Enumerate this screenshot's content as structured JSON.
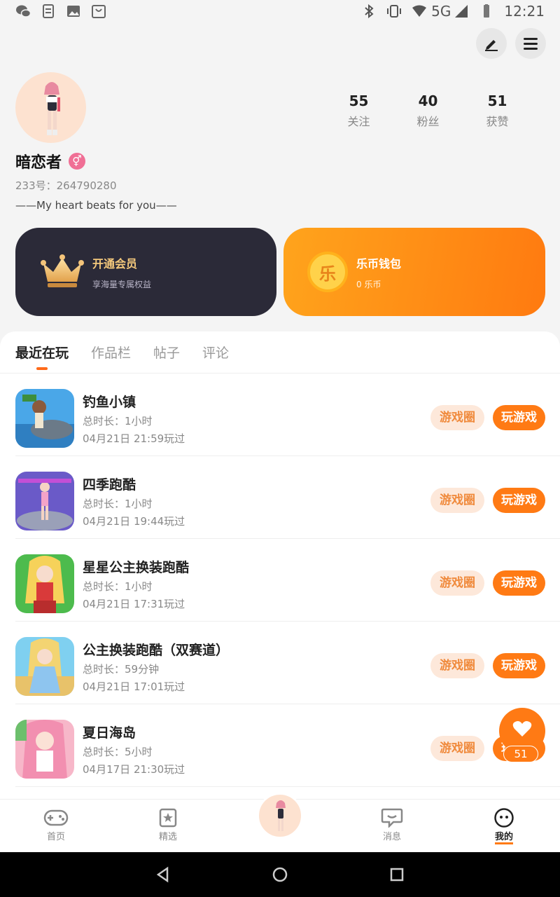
{
  "status_bar": {
    "network": "5G",
    "time": "12:21"
  },
  "profile": {
    "username": "暗恋者",
    "gender_symbol": "⚥",
    "uid_text": "233号：264790280",
    "bio": "——My heart beats for you——",
    "stats": [
      {
        "num": "55",
        "label": "关注"
      },
      {
        "num": "40",
        "label": "粉丝"
      },
      {
        "num": "51",
        "label": "获赞"
      }
    ]
  },
  "cards": {
    "vip": {
      "title": "开通会员",
      "subtitle": "享海量专属权益"
    },
    "wallet": {
      "icon_text": "乐",
      "title": "乐币钱包",
      "subtitle": "0 乐币"
    }
  },
  "tabs": [
    "最近在玩",
    "作品栏",
    "帖子",
    "评论"
  ],
  "games": [
    {
      "name": "钓鱼小镇",
      "duration": "总时长：1小时",
      "last_played": "04月21日 21:59玩过",
      "circle_label": "游戏圈",
      "play_label": "玩游戏"
    },
    {
      "name": "四季跑酷",
      "duration": "总时长：1小时",
      "last_played": "04月21日 19:44玩过",
      "circle_label": "游戏圈",
      "play_label": "玩游戏"
    },
    {
      "name": "星星公主换装跑酷",
      "duration": "总时长：1小时",
      "last_played": "04月21日 17:31玩过",
      "circle_label": "游戏圈",
      "play_label": "玩游戏"
    },
    {
      "name": "公主换装跑酷（双赛道）",
      "duration": "总时长：59分钟",
      "last_played": "04月21日 17:01玩过",
      "circle_label": "游戏圈",
      "play_label": "玩游戏"
    },
    {
      "name": "夏日海岛",
      "duration": "总时长：5小时",
      "last_played": "04月17日 21:30玩过",
      "circle_label": "游戏圈",
      "play_label": "玩游戏"
    }
  ],
  "like_fab": {
    "count": "51"
  },
  "bottom_nav": [
    {
      "label": "首页",
      "icon": "gamepad-icon"
    },
    {
      "label": "精选",
      "icon": "star-bookmark-icon"
    },
    {
      "label": "消息",
      "icon": "chat-bubble-icon"
    },
    {
      "label": "我的",
      "icon": "smiley-face-icon"
    }
  ],
  "colors": {
    "accent": "#ff7a14",
    "vip_card": "#2b2a38",
    "gender": "#f06f95"
  }
}
